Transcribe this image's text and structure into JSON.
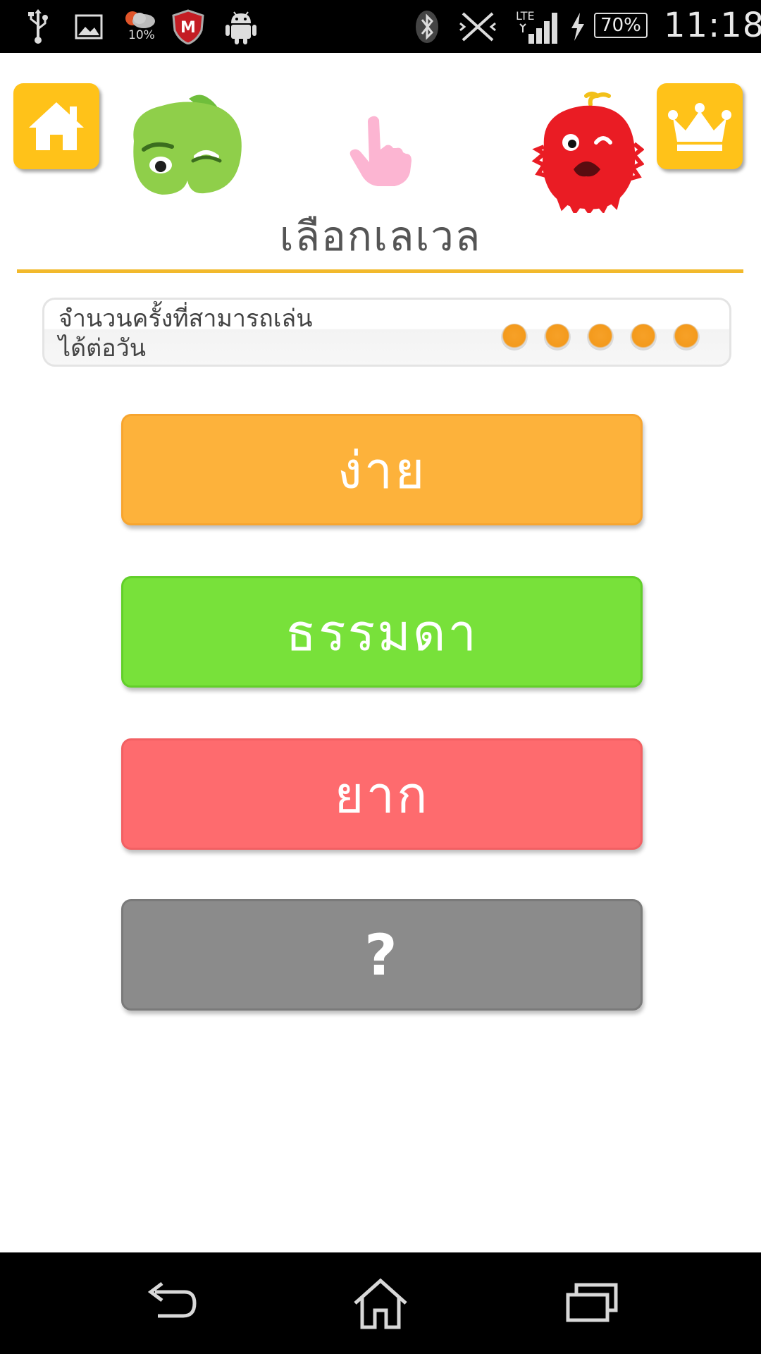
{
  "status_bar": {
    "weather_percent": "10%",
    "battery_level": "70%",
    "network_type": "LTE",
    "time": "11:18",
    "icons": [
      "usb-icon",
      "gallery-icon",
      "weather-icon",
      "mcafee-icon",
      "android-debug-icon",
      "bluetooth-icon",
      "vibrate-icon",
      "signal-icon",
      "charging-icon",
      "battery-icon"
    ]
  },
  "header": {
    "title": "เลือกเลเวล",
    "home_icon": "home-icon",
    "ranking_icon": "crown-icon",
    "pointer_icon": "pointing-hand-icon"
  },
  "plays_per_day": {
    "label": "จำนวนครั้งที่สามารถเล่นได้ต่อวัน",
    "remaining": 5,
    "dot_color": "#f49a1c"
  },
  "levels": {
    "easy": "ง่าย",
    "normal": "ธรรมดา",
    "hard": "ยาก",
    "unknown": "?"
  },
  "colors": {
    "accent": "#ffc219",
    "easy": "#fdb23b",
    "normal": "#78e13a",
    "hard": "#fe6b6e",
    "unknown": "#8b8b8b"
  },
  "nav_bar": {
    "icons": [
      "back-icon",
      "home-icon",
      "recent-apps-icon"
    ]
  }
}
